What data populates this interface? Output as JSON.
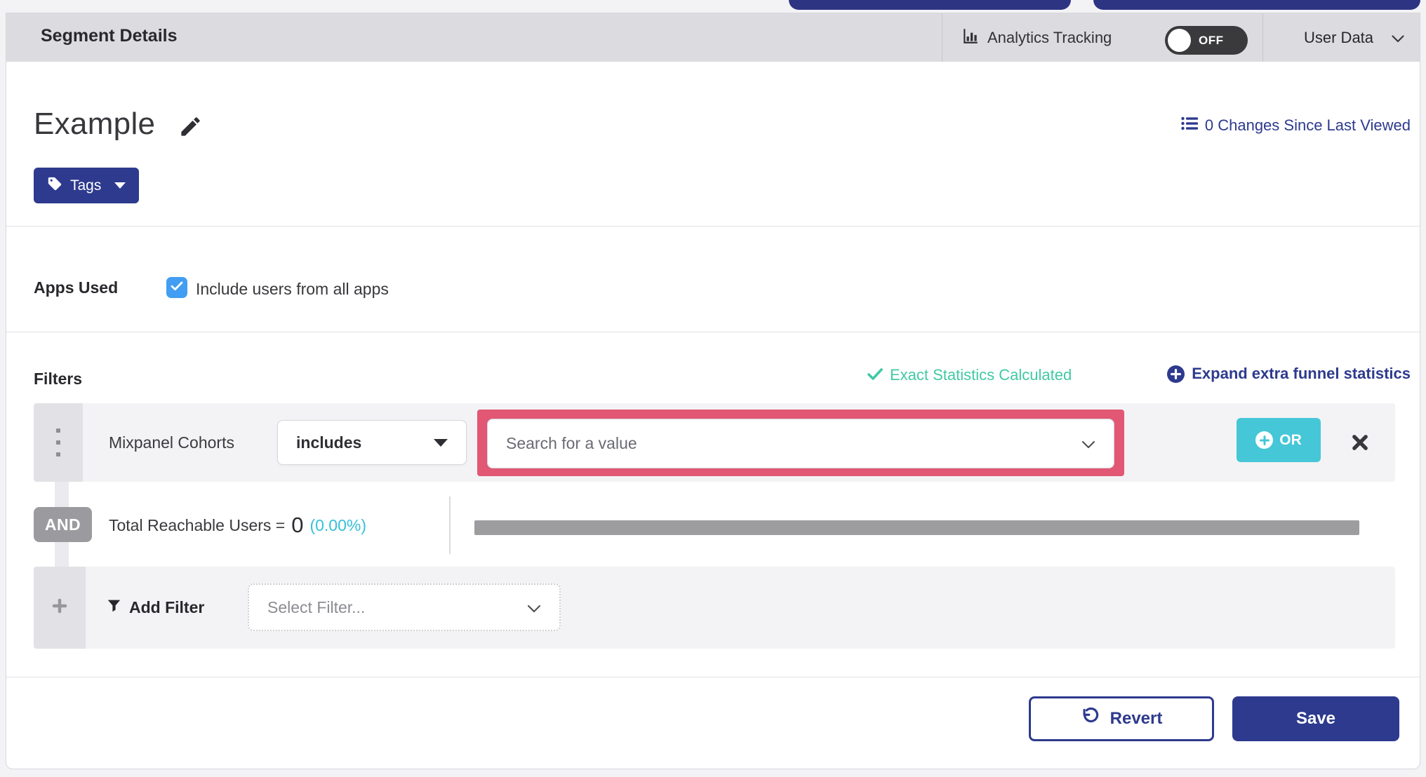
{
  "header": {
    "title": "Segment Details",
    "analytics_tracking": {
      "label": "Analytics Tracking",
      "toggle_state": "OFF"
    },
    "user_data": {
      "label": "User Data"
    }
  },
  "segment": {
    "name": "Example",
    "changes_link": "0 Changes Since Last Viewed",
    "tags_button": "Tags"
  },
  "apps_used": {
    "label": "Apps Used",
    "include_all_label": "Include users from all apps",
    "include_all_checked": true
  },
  "filters": {
    "title": "Filters",
    "exact_statistics": "Exact Statistics Calculated",
    "expand_link": "Expand extra funnel statistics",
    "filter_row": {
      "field": "Mixpanel Cohorts",
      "operator": "includes",
      "value_placeholder": "Search for a value",
      "or_button": "OR"
    },
    "conjunction": "AND",
    "reachable_users": {
      "label": "Total Reachable Users =",
      "value": "0",
      "percent": "(0.00%)"
    },
    "add_filter": {
      "label": "Add Filter",
      "placeholder": "Select Filter..."
    }
  },
  "footer": {
    "revert": "Revert",
    "save": "Save"
  },
  "icons": {
    "analytics": "bar-chart-icon",
    "toggle": "switch-off",
    "user_data": "chevron-down-icon",
    "edit": "pencil-icon",
    "changes": "list-icon",
    "tags": "tag-icon",
    "checkbox": "check-icon",
    "status": "check-icon",
    "expand": "plus-circle-icon",
    "drag": "drag-dots-icon",
    "or": "plus-circle-icon",
    "remove": "close-x-icon",
    "add": "plus-icon",
    "add_filter": "funnel-icon",
    "revert": "undo-icon"
  },
  "colors": {
    "brand_blue": "#2d3a8e",
    "teal": "#45c7d8",
    "mint_green": "#41c9a3",
    "cyan": "#35c1d8",
    "highlight_pink": "#e25774",
    "checkbox_blue": "#419ef2",
    "toggle_dark": "#3a3a3d",
    "header_gray": "#dcdce0",
    "row_gray": "#f3f3f5",
    "progress_gray": "#9d9da0"
  }
}
